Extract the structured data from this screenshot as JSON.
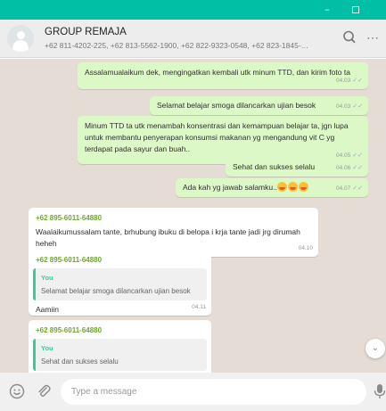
{
  "window": {
    "minimize_glyph": "–"
  },
  "header": {
    "group_name": "GROUP REMAJA",
    "participants": "+62 811-4202-225, +62 813-5562-1900, +62 822-9323-0548, +62 823-1845-91...",
    "menu_glyph": "⋯"
  },
  "messages": [
    {
      "type": "out",
      "text": "Assalamualaikum dek, mengingatkan kembali utk minum TTD, dan kirim foto ta",
      "time": "04.03"
    },
    {
      "type": "out",
      "text": "Selamat belajar smoga dilancarkan ujian besok",
      "time": "04.03"
    },
    {
      "type": "out",
      "text": "Minum TTD ta utk menambah konsentrasi dan kemampuan belajar ta, jgn lupa untuk membantu penyerapan konsumsi makanan yg mengandung vit C yg terdapat pada sayur dan buah..",
      "time": "04.05"
    },
    {
      "type": "out",
      "text": "Sehat dan sukses selalu",
      "time": "04.06"
    },
    {
      "type": "out",
      "text": "Ada kah yg jawab salamku..",
      "time": "04.07"
    },
    {
      "type": "in",
      "sender": "+62 895-6011-64880",
      "text": "Waalaikumussalam tante, brhubung ibuku di belopa i krja tante jadi jrg dirumah heheh",
      "time": "04.10"
    },
    {
      "type": "in",
      "sender": "+62 895-6011-64880",
      "quote_author": "You",
      "quote_text": "Selamat belajar smoga dilancarkan ujian besok",
      "text": "Aamiin",
      "time": "04.11"
    },
    {
      "type": "in",
      "sender": "+62 895-6011-64880",
      "quote_author": "You",
      "quote_text": "Sehat dan sukses selalu"
    }
  ],
  "ticks": "✓✓",
  "scroll_glyph": "⌄",
  "composer": {
    "placeholder": "Type a message"
  },
  "colors": {
    "titlebar": "#00bfa5",
    "outgoing_bubble": "#dcf8c6",
    "incoming_bubble": "#ffffff",
    "chat_background": "#e5ddd5",
    "sender_name": "#6fa82a",
    "quote_accent": "#35cd96"
  }
}
